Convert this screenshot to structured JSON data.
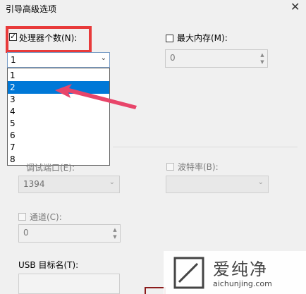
{
  "dialog": {
    "title": "引导高级选项"
  },
  "processor": {
    "label": "处理器个数(N):",
    "selected": "1",
    "options": [
      "1",
      "2",
      "3",
      "4",
      "5",
      "6",
      "7",
      "8"
    ],
    "highlighted_index": 1
  },
  "max_memory": {
    "label": "最大内存(M):",
    "value": "0"
  },
  "debug": {
    "port_label": "调试端口(E):",
    "port_value": "1394",
    "baud_label": "波特率(B):",
    "channel_label": "通道(C):",
    "channel_value": "0"
  },
  "usb": {
    "label": "USB 目标名(T):"
  },
  "watermark": {
    "brand": "爱纯净",
    "url": "aichunjing.com"
  },
  "colors": {
    "highlight": "#e83a3a",
    "selection": "#0078d7",
    "arrow": "#e8456a"
  }
}
